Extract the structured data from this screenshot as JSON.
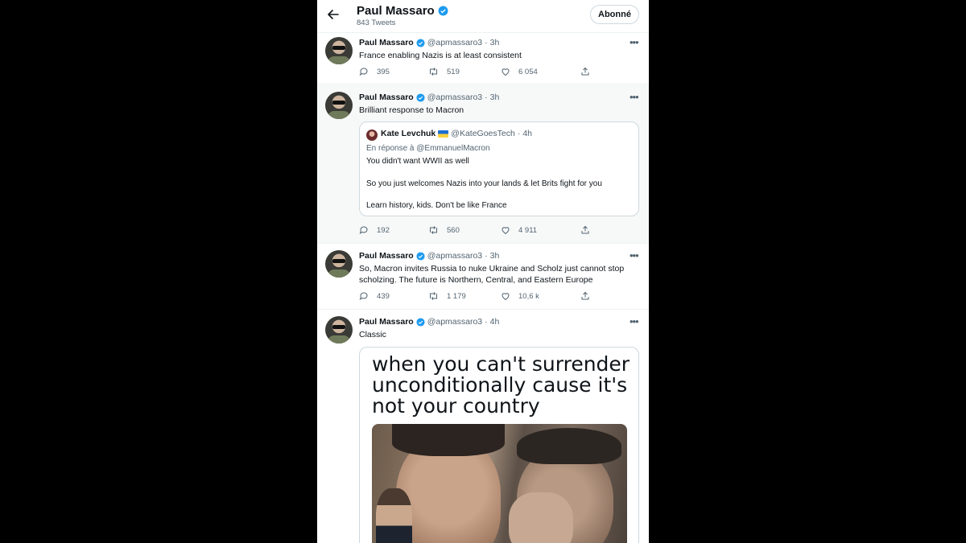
{
  "colors": {
    "background": "#000000",
    "panel": "#ffffff",
    "verified": "#1d9bf0",
    "muted": "#536471",
    "text": "#0f1419"
  },
  "header": {
    "back_icon": "arrow-left-icon",
    "name": "Paul Massaro",
    "tweet_count": "843 Tweets",
    "follow_label": "Abonné"
  },
  "tweets": [
    {
      "name": "Paul Massaro",
      "handle": "@apmassaro3",
      "dot": "·",
      "time": "3h",
      "text": "France enabling Nazis is at least consistent",
      "replies": "395",
      "retweets": "519",
      "likes": "6 054"
    },
    {
      "name": "Paul Massaro",
      "handle": "@apmassaro3",
      "dot": "·",
      "time": "3h",
      "text": "Brilliant response to Macron",
      "quote": {
        "name": "Kate Levchuk",
        "handle": "@KateGoesTech",
        "dot": "·",
        "time": "4h",
        "reply_to": "En réponse à @EmmanuelMacron",
        "line1": "You didn't want WWII as well",
        "line2": "So you just welcomes Nazis into your lands & let Brits fight for you",
        "line3": "Learn history, kids. Don't be like France"
      },
      "replies": "192",
      "retweets": "560",
      "likes": "4 911"
    },
    {
      "name": "Paul Massaro",
      "handle": "@apmassaro3",
      "dot": "·",
      "time": "3h",
      "text": "So, Macron invites Russia to nuke Ukraine and Scholz just cannot stop scholzing. The future is Northern, Central, and Eastern Europe",
      "replies": "439",
      "retweets": "1 179",
      "likes": "10,6 k"
    },
    {
      "name": "Paul Massaro",
      "handle": "@apmassaro3",
      "dot": "·",
      "time": "4h",
      "text": "Classic",
      "meme_caption": "when you can't surrender unconditionally cause it's not your country"
    }
  ],
  "icons": [
    "reply-icon",
    "retweet-icon",
    "like-icon",
    "share-icon",
    "more-icon",
    "verified-badge-icon"
  ]
}
